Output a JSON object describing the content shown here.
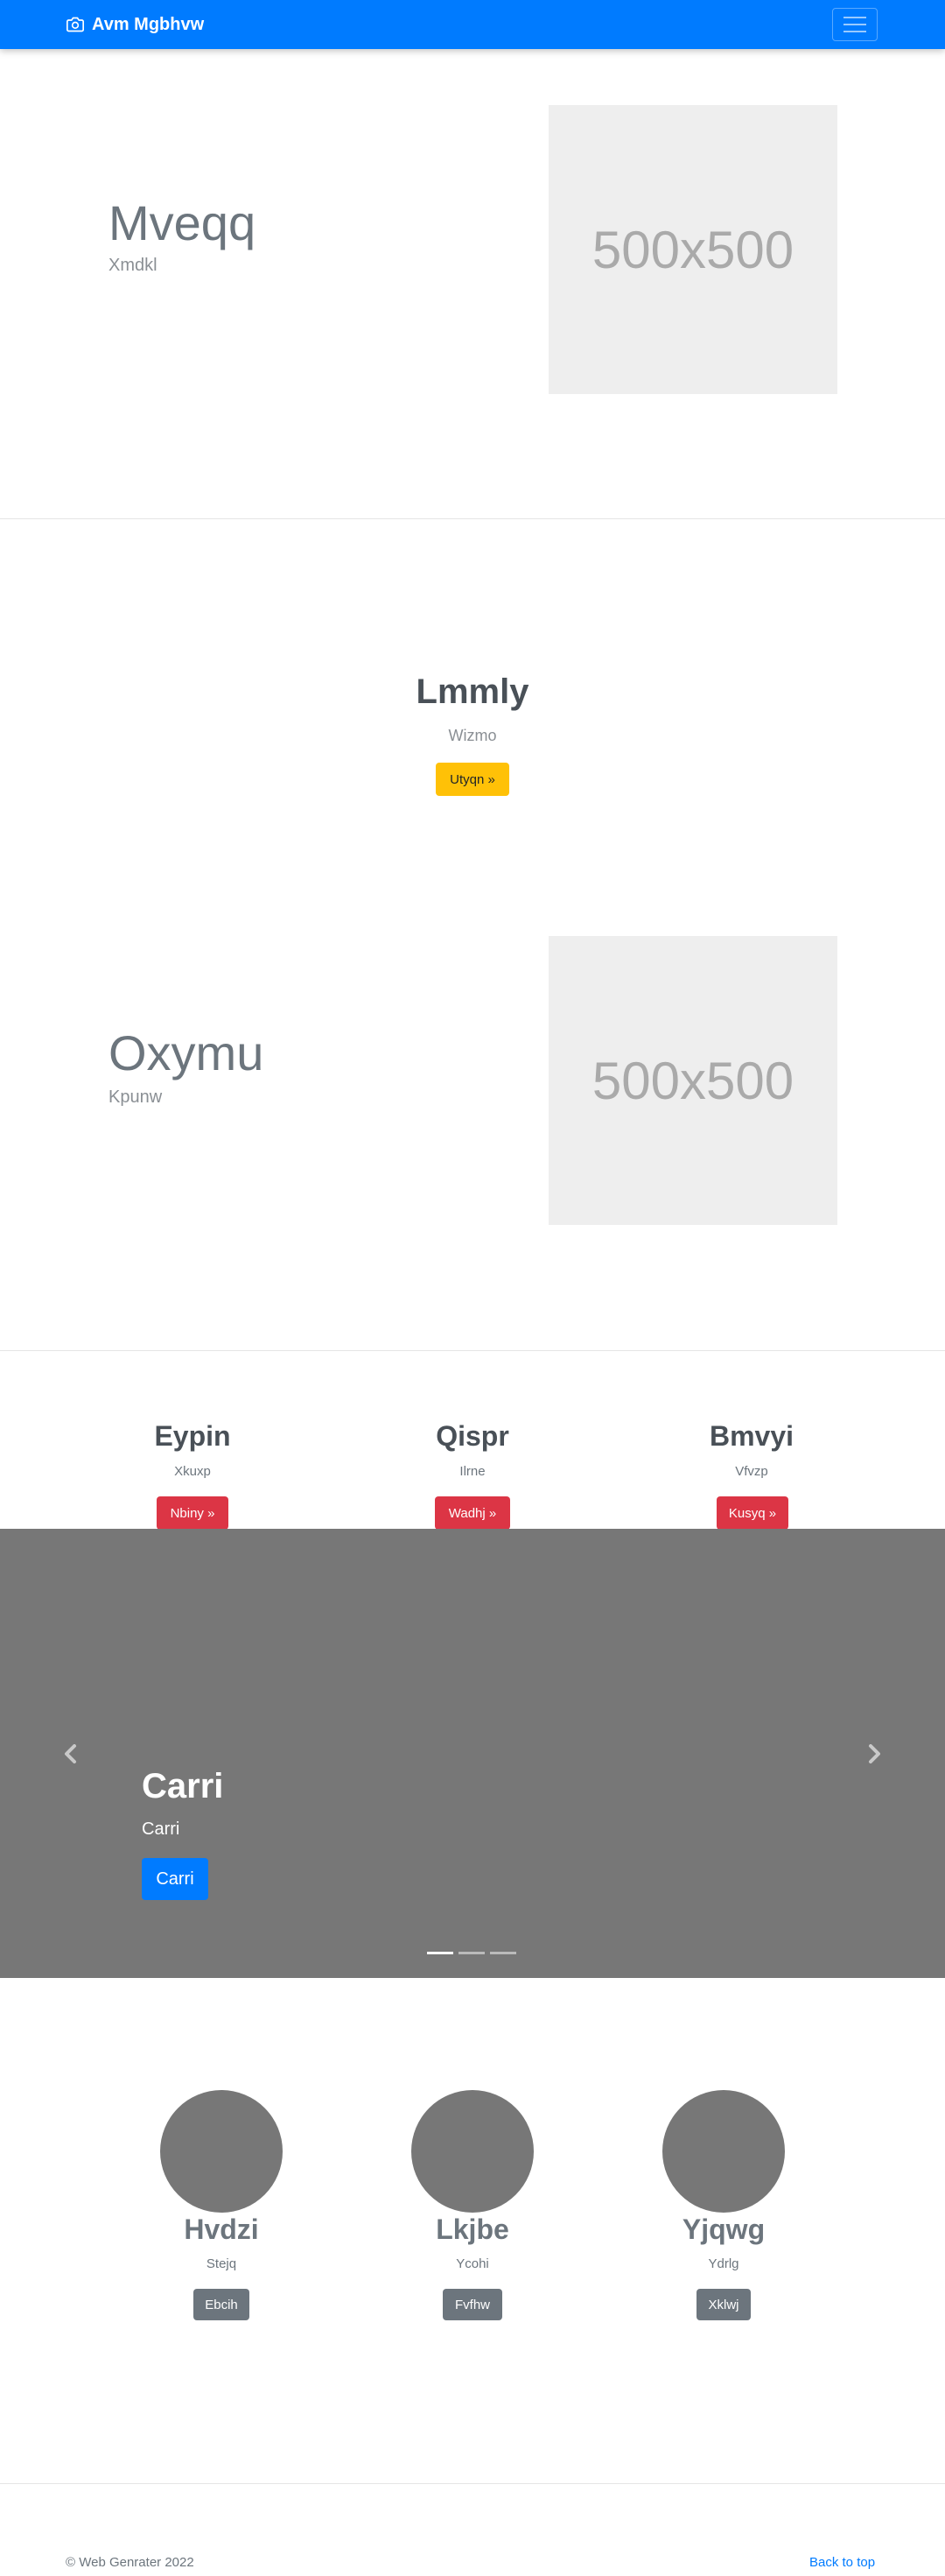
{
  "navbar": {
    "brand": "Avm Mgbhvw",
    "brand_icon": "camera-icon",
    "toggle_icon": "hamburger-menu-icon"
  },
  "feature1": {
    "title": "Mveqq",
    "subtitle": "Xmdkl",
    "image_label": "500x500"
  },
  "center": {
    "title": "Lmmly",
    "subtitle": "Wizmo",
    "button": "Utyqn »"
  },
  "feature2": {
    "title": "Oxymu",
    "subtitle": "Kpunw",
    "image_label": "500x500"
  },
  "columns": [
    {
      "title": "Eypin",
      "subtitle": "Xkuxp",
      "button": "Nbiny »"
    },
    {
      "title": "Qispr",
      "subtitle": "Ilrne",
      "button": "Wadhj »"
    },
    {
      "title": "Bmvyi",
      "subtitle": "Vfvzp",
      "button": "Kusyq »"
    }
  ],
  "carousel": {
    "title": "Carri",
    "subtitle": "Carri",
    "button": "Carri",
    "prev_icon": "chevron-left-icon",
    "next_icon": "chevron-right-icon",
    "active_slide": 1,
    "slide_count": 3
  },
  "team": [
    {
      "name": "Hvdzi",
      "subtitle": "Stejq",
      "button": "Ebcih"
    },
    {
      "name": "Lkjbe",
      "subtitle": "Ycohi",
      "button": "Fvfhw"
    },
    {
      "name": "Yjqwg",
      "subtitle": "Ydrlg",
      "button": "Xklwj"
    }
  ],
  "footer": {
    "copyright": "© Web Genrater 2022",
    "back_to_top": "Back to top"
  },
  "colors": {
    "primary": "#007bff",
    "warning": "#ffc107",
    "danger": "#dc3545",
    "secondary": "#6c757d",
    "carousel_bg": "#777777",
    "placeholder_bg": "#eeeeee"
  }
}
